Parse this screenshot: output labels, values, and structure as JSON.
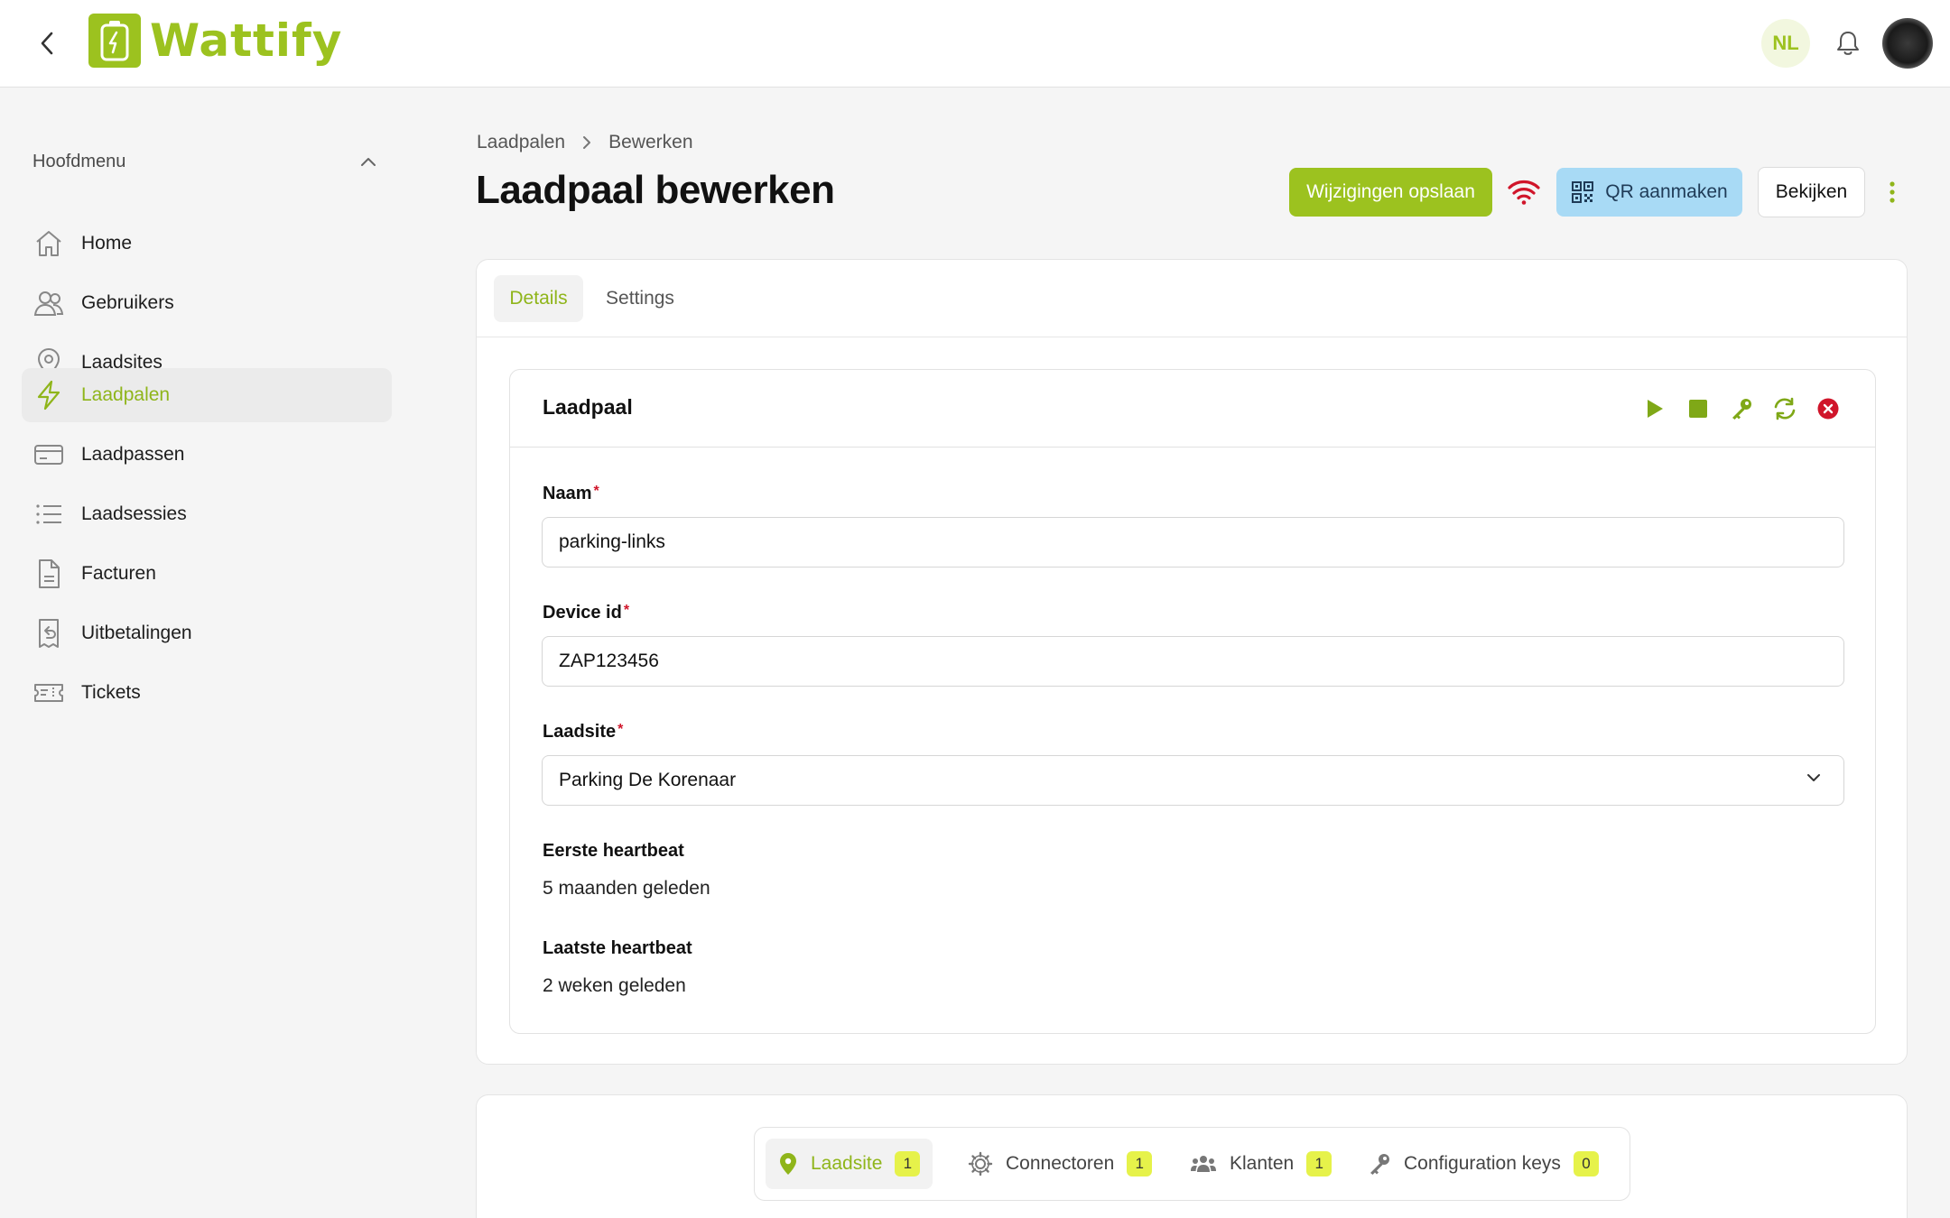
{
  "brand": {
    "name": "Wattify",
    "accent": "#9cc21f"
  },
  "topbar": {
    "language": "NL"
  },
  "sidebar": {
    "section_label": "Hoofdmenu",
    "items": [
      {
        "label": "Home",
        "icon": "home-icon"
      },
      {
        "label": "Gebruikers",
        "icon": "users-icon"
      },
      {
        "label": "Laadsites",
        "icon": "location-pin-icon"
      },
      {
        "label": "Laadpalen",
        "icon": "lightning-icon",
        "active": true
      },
      {
        "label": "Laadpassen",
        "icon": "card-icon"
      },
      {
        "label": "Laadsessies",
        "icon": "list-icon"
      },
      {
        "label": "Facturen",
        "icon": "document-icon"
      },
      {
        "label": "Uitbetalingen",
        "icon": "receipt-icon"
      },
      {
        "label": "Tickets",
        "icon": "ticket-icon"
      }
    ]
  },
  "breadcrumb": {
    "parent": "Laadpalen",
    "current": "Bewerken"
  },
  "page": {
    "title": "Laadpaal bewerken"
  },
  "actions": {
    "save": "Wijzigingen opslaan",
    "qr": "QR aanmaken",
    "view": "Bekijken"
  },
  "tabs": [
    {
      "label": "Details",
      "active": true
    },
    {
      "label": "Settings",
      "active": false
    }
  ],
  "detail_card": {
    "title": "Laadpaal",
    "fields": {
      "naam": {
        "label": "Naam",
        "value": "parking-links"
      },
      "device": {
        "label": "Device id",
        "value": "ZAP123456"
      },
      "laadsite": {
        "label": "Laadsite",
        "value": "Parking De Korenaar"
      },
      "eerste": {
        "label": "Eerste heartbeat",
        "value": "5 maanden geleden"
      },
      "laatste": {
        "label": "Laatste heartbeat",
        "value": "2 weken geleden"
      }
    }
  },
  "bottom_tabs": [
    {
      "label": "Laadsite",
      "count": "1",
      "active": true
    },
    {
      "label": "Connectoren",
      "count": "1"
    },
    {
      "label": "Klanten",
      "count": "1"
    },
    {
      "label": "Configuration keys",
      "count": "0"
    }
  ]
}
